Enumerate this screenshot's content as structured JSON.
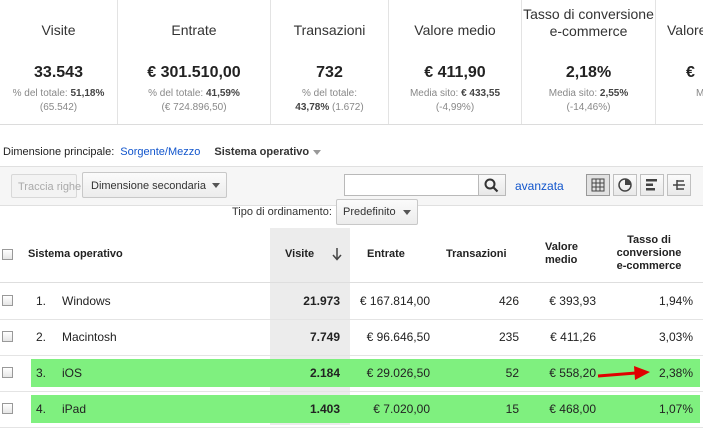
{
  "summary": [
    {
      "title": "Visite",
      "value": "33.543",
      "sub_label": "% del totale:",
      "sub_value": "51,18%",
      "sub2": "(65.542)"
    },
    {
      "title": "Entrate",
      "value": "€ 301.510,00",
      "sub_label": "% del totale:",
      "sub_value": "41,59%",
      "sub2": "(€ 724.896,50)"
    },
    {
      "title": "Transazioni",
      "value": "732",
      "sub_label": "% del totale:",
      "sub_value": "43,78%",
      "sub_tail": "(1.672)"
    },
    {
      "title": "Valore medio",
      "value": "€ 411,90",
      "sub_label": "Media sito:",
      "sub_value": "€ 433,55",
      "sub2": "(-4,99%)"
    },
    {
      "title": "Tasso di conversione",
      "title2": "e-commerce",
      "value": "2,18%",
      "sub_label": "Media sito:",
      "sub_value": "2,55%",
      "sub2": "(-14,46%)"
    },
    {
      "title": "Valore",
      "value": "€",
      "sub_label": "Me"
    }
  ],
  "dimensions": {
    "label": "Dimensione principale:",
    "link": "Sorgente/Mezzo",
    "active": "Sistema operativo"
  },
  "toolbar": {
    "plot_rows": "Traccia righe",
    "secondary_dim": "Dimensione secondaria",
    "search_value": "",
    "advanced": "avanzata",
    "views": [
      "table-view-icon",
      "pie-view-icon",
      "bar-view-icon",
      "pivot-view-icon"
    ]
  },
  "sort": {
    "label": "Tipo di ordinamento:",
    "value": "Predefinito"
  },
  "table": {
    "headers": {
      "dimension": "Sistema operativo",
      "visits": "Visite",
      "revenue": "Entrate",
      "transactions": "Transazioni",
      "avg_value_1": "Valore",
      "avg_value_2": "medio",
      "conv_1": "Tasso di",
      "conv_2": "conversione",
      "conv_3": "e-commerce"
    },
    "rows": [
      {
        "index": "1.",
        "name": "Windows",
        "visits": "21.973",
        "revenue": "€ 167.814,00",
        "transactions": "426",
        "avg": "€ 393,93",
        "conv": "1,94%",
        "highlight": false
      },
      {
        "index": "2.",
        "name": "Macintosh",
        "visits": "7.749",
        "revenue": "€ 96.646,50",
        "transactions": "235",
        "avg": "€ 411,26",
        "conv": "3,03%",
        "highlight": false
      },
      {
        "index": "3.",
        "name": "iOS",
        "visits": "2.184",
        "revenue": "€ 29.026,50",
        "transactions": "52",
        "avg": "€ 558,20",
        "conv": "2,38%",
        "highlight": true
      },
      {
        "index": "4.",
        "name": "iPad",
        "visits": "1.403",
        "revenue": "€ 7.020,00",
        "transactions": "15",
        "avg": "€ 468,00",
        "conv": "1,07%",
        "highlight": true
      }
    ]
  },
  "colors": {
    "highlight": "#7ff07f",
    "link": "#1155cc",
    "arrow": "#e00000"
  }
}
